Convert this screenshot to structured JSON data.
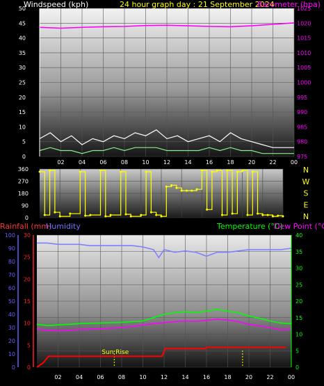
{
  "colors": {
    "background": "#000000",
    "wind": "#ffffff",
    "wind_avg": "#00dd00",
    "wind_gust_fill": "#88ee88",
    "barometer": "#ff00ff",
    "direction": "#ffff00",
    "rainfall": "#ff0000",
    "humidity": "#8080ff",
    "temperature": "#00ff00",
    "dewpoint": "#ff00ff",
    "sunrise": "#ffff00",
    "rain_axis": "#ff2020",
    "humidity_axis": "#6060ff"
  },
  "chart_data": [
    {
      "id": "wind-baro",
      "type": "line",
      "header": {
        "left": "Windspeed (kph)",
        "center": "24 hour graph day : 21 September 2024",
        "right": "Barometer (hpa)"
      },
      "x_ticks": [
        "02",
        "04",
        "06",
        "08",
        "10",
        "12",
        "14",
        "16",
        "18",
        "20",
        "22",
        "00"
      ],
      "y_left_ticks": [
        "0",
        "5",
        "10",
        "15",
        "20",
        "25",
        "30",
        "35",
        "40",
        "45",
        "50"
      ],
      "y_left_lim": [
        0,
        50
      ],
      "y_right_ticks": [
        "975",
        "980",
        "985",
        "990",
        "995",
        "1000",
        "1005",
        "1010",
        "1015",
        "1020",
        "1025"
      ],
      "y_right_lim": [
        975,
        1025
      ],
      "grid": true,
      "series": [
        {
          "key": "wind_gust",
          "x": [
            0,
            1,
            2,
            3,
            4,
            5,
            6,
            7,
            8,
            9,
            10,
            11,
            12,
            13,
            14,
            15,
            16,
            17,
            18,
            19,
            20,
            21,
            22,
            23,
            24
          ],
          "values": [
            6,
            8,
            5,
            7,
            4,
            6,
            5,
            7,
            6,
            8,
            7,
            9,
            6,
            7,
            5,
            6,
            7,
            5,
            8,
            6,
            5,
            4,
            3,
            3,
            3
          ]
        },
        {
          "key": "wind_avg",
          "x": [
            0,
            1,
            2,
            3,
            4,
            5,
            6,
            7,
            8,
            9,
            10,
            11,
            12,
            13,
            14,
            15,
            16,
            17,
            18,
            19,
            20,
            21,
            22,
            23,
            24
          ],
          "values": [
            2,
            3,
            2,
            2,
            1,
            2,
            2,
            3,
            2,
            3,
            3,
            3,
            2,
            2,
            2,
            2,
            3,
            2,
            3,
            2,
            2,
            1,
            1,
            1,
            1
          ]
        },
        {
          "key": "barometer",
          "x": [
            0,
            2,
            4,
            6,
            8,
            10,
            12,
            14,
            16,
            18,
            20,
            22,
            24
          ],
          "values": [
            1018.6,
            1018.3,
            1018.6,
            1018.8,
            1018.9,
            1019.2,
            1019.3,
            1019.1,
            1018.9,
            1018.8,
            1019.1,
            1019.6,
            1020.1
          ]
        }
      ]
    },
    {
      "id": "wind-direction",
      "type": "scatter",
      "x_ticks": [
        "02",
        "04",
        "06",
        "08",
        "10",
        "12",
        "14",
        "16",
        "18",
        "20",
        "22",
        "00"
      ],
      "y_left_ticks": [
        "0",
        "90",
        "180",
        "270",
        "360"
      ],
      "y_left_lim": [
        0,
        360
      ],
      "compass_labels": [
        "N",
        "W",
        "S",
        "E",
        "N"
      ],
      "grid": true,
      "series": [
        {
          "key": "direction",
          "x": [
            0,
            0.5,
            1,
            1.5,
            2,
            3,
            4,
            4.5,
            5,
            6,
            6.5,
            7,
            8,
            8.5,
            9,
            10,
            10.5,
            11,
            11.5,
            12,
            12.5,
            13,
            13.5,
            14,
            14.5,
            15,
            15.5,
            16,
            16.5,
            17,
            17.5,
            18,
            18.5,
            19,
            19.5,
            20,
            20.5,
            21,
            21.5,
            22,
            22.5,
            23,
            23.5,
            24
          ],
          "values": [
            340,
            20,
            350,
            40,
            10,
            30,
            340,
            15,
            20,
            350,
            10,
            20,
            340,
            25,
            10,
            20,
            340,
            40,
            20,
            10,
            230,
            240,
            220,
            200,
            200,
            200,
            210,
            350,
            60,
            340,
            350,
            20,
            350,
            30,
            340,
            350,
            20,
            340,
            30,
            20,
            20,
            10,
            15,
            10
          ]
        }
      ]
    },
    {
      "id": "temp-rain-hum",
      "type": "line",
      "header": {
        "rain": "Rainfall (mm)",
        "humidity": "Humidity",
        "temperature": "Temperature (°C)",
        "dewpoint": "Dew Point (°C)"
      },
      "annotation": "Sun Rise",
      "x_ticks": [
        "02",
        "04",
        "06",
        "08",
        "10",
        "12",
        "14",
        "16",
        "18",
        "20",
        "22",
        "00"
      ],
      "y_hum_ticks": [
        "0",
        "10",
        "20",
        "30",
        "40",
        "50",
        "60",
        "70",
        "80",
        "90",
        "100"
      ],
      "y_hum_lim": [
        0,
        100
      ],
      "y_rain_ticks": [
        "0",
        "5",
        "10",
        "15",
        "20",
        "25",
        "30"
      ],
      "y_rain_lim": [
        0,
        30
      ],
      "y_temp_ticks": [
        "0",
        "5",
        "10",
        "15",
        "20",
        "25",
        "30",
        "35",
        "40"
      ],
      "y_temp_lim": [
        0,
        40
      ],
      "sunrise_hour": 7.3,
      "sunset_hour": 19.4,
      "grid": true,
      "series": [
        {
          "key": "humidity",
          "x": [
            0,
            1,
            2,
            3,
            4,
            5,
            6,
            7,
            8,
            9,
            10,
            11,
            11.5,
            12,
            13,
            14,
            15,
            16,
            17,
            18,
            19,
            20,
            21,
            22,
            23,
            24
          ],
          "values": [
            94,
            94,
            93,
            93,
            93,
            92,
            92,
            92,
            92,
            92,
            91,
            89,
            83,
            89,
            87,
            88,
            87,
            84,
            87,
            87,
            88,
            89,
            89,
            89,
            89,
            90
          ]
        },
        {
          "key": "temperature",
          "x": [
            0,
            1,
            2,
            3,
            4,
            5,
            6,
            7,
            8,
            9,
            10,
            11,
            12,
            13,
            14,
            15,
            16,
            17,
            18,
            19,
            20,
            21,
            22,
            23,
            24
          ],
          "values": [
            13,
            12.6,
            12.8,
            13,
            13.2,
            13.3,
            13.4,
            13.5,
            13.6,
            13.8,
            14,
            15,
            16,
            16.5,
            16.8,
            16.5,
            17,
            17.5,
            17,
            16.5,
            15.5,
            14.8,
            14,
            13.4,
            13.2
          ]
        },
        {
          "key": "dewpoint",
          "x": [
            0,
            1,
            2,
            3,
            4,
            5,
            6,
            7,
            8,
            9,
            10,
            11,
            12,
            13,
            14,
            15,
            16,
            17,
            18,
            19,
            20,
            21,
            22,
            23,
            24
          ],
          "values": [
            11.5,
            11.2,
            11,
            11.2,
            11.4,
            11.5,
            11.6,
            11.8,
            12,
            12.3,
            12.8,
            13.2,
            13.5,
            13.8,
            14,
            13.9,
            14.2,
            14.5,
            14.3,
            13.8,
            13,
            12.5,
            12,
            11.3,
            11.5
          ]
        },
        {
          "key": "rainfall",
          "x": [
            0,
            0.6,
            1.1,
            6,
            11.8,
            11.9,
            12.1,
            15.9,
            16,
            23.5
          ],
          "values": [
            0,
            1,
            2.5,
            2.5,
            2.5,
            3,
            4.2,
            4.2,
            4.5,
            4.5
          ]
        }
      ]
    }
  ]
}
